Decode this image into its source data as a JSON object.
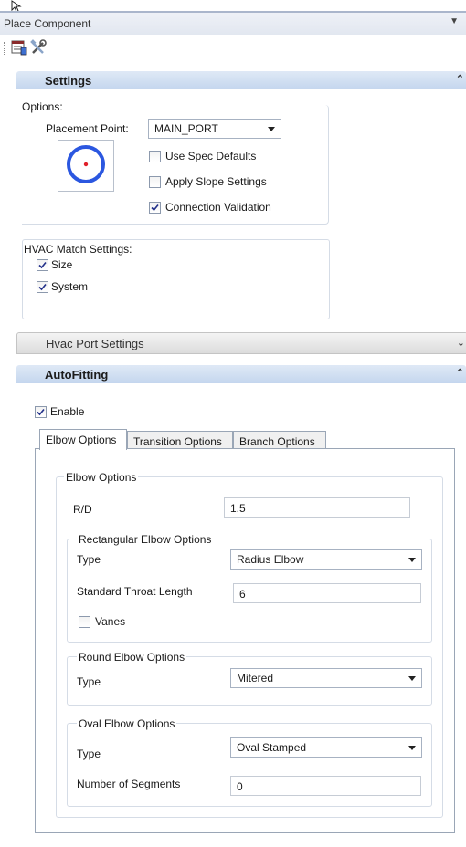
{
  "title": "Place Component",
  "settings": {
    "header": "Settings",
    "options_label": "Options:",
    "placement_point_label": "Placement Point:",
    "placement_point_value": "MAIN_PORT",
    "use_spec_defaults": {
      "label": "Use Spec Defaults",
      "checked": false
    },
    "apply_slope_settings": {
      "label": "Apply Slope Settings",
      "checked": false
    },
    "connection_validation": {
      "label": "Connection Validation",
      "checked": true
    },
    "hvac_match_label": "HVAC Match Settings:",
    "size": {
      "label": "Size",
      "checked": true
    },
    "system": {
      "label": "System",
      "checked": true
    }
  },
  "hvac_port_settings": {
    "header": "Hvac Port Settings"
  },
  "autofitting": {
    "header": "AutoFitting",
    "enable": {
      "label": "Enable",
      "checked": true
    },
    "tabs": [
      "Elbow Options",
      "Transition Options",
      "Branch Options"
    ],
    "elbow": {
      "group_label": "Elbow Options",
      "rd_label": "R/D",
      "rd_value": "1.5",
      "rectangular": {
        "group_label": "Rectangular Elbow Options",
        "type_label": "Type",
        "type_value": "Radius Elbow",
        "throat_label": "Standard Throat Length",
        "throat_value": "6",
        "vanes": {
          "label": "Vanes",
          "checked": false
        }
      },
      "round": {
        "group_label": "Round  Elbow Options",
        "type_label": "Type",
        "type_value": "Mitered"
      },
      "oval": {
        "group_label": "Oval Elbow Options",
        "type_label": "Type",
        "type_value": "Oval Stamped",
        "segments_label": "Number of Segments",
        "segments_value": "0"
      }
    }
  },
  "colors": {
    "section_header": "#c4d6ee",
    "accent": "#2b57e0",
    "dot": "#e0202a"
  }
}
